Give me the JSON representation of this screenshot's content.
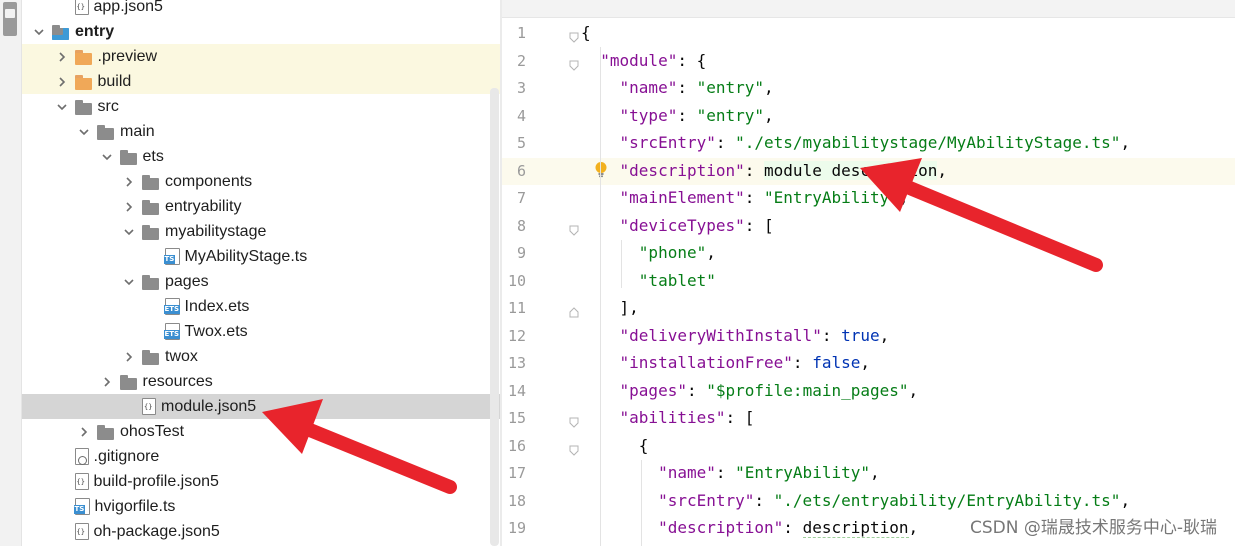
{
  "tree": {
    "items": [
      {
        "label": "app.json5",
        "icon": "json-file-icon",
        "depth": 3,
        "chevron": "none"
      },
      {
        "label": "entry",
        "icon": "module-folder-icon",
        "depth": 2,
        "chevron": "down",
        "bold": true
      },
      {
        "label": ".preview",
        "icon": "excluded-folder-icon",
        "depth": 3,
        "chevron": "right",
        "highlight": true
      },
      {
        "label": "build",
        "icon": "excluded-folder-icon",
        "depth": 3,
        "chevron": "right",
        "highlight": true
      },
      {
        "label": "src",
        "icon": "folder-icon",
        "depth": 3,
        "chevron": "down"
      },
      {
        "label": "main",
        "icon": "folder-icon",
        "depth": 4,
        "chevron": "down"
      },
      {
        "label": "ets",
        "icon": "folder-icon",
        "depth": 5,
        "chevron": "down"
      },
      {
        "label": "components",
        "icon": "folder-icon",
        "depth": 6,
        "chevron": "right"
      },
      {
        "label": "entryability",
        "icon": "folder-icon",
        "depth": 6,
        "chevron": "right"
      },
      {
        "label": "myabilitystage",
        "icon": "folder-icon",
        "depth": 6,
        "chevron": "down"
      },
      {
        "label": "MyAbilityStage.ts",
        "icon": "ts-file-icon",
        "depth": 7,
        "chevron": "none"
      },
      {
        "label": "pages",
        "icon": "folder-icon",
        "depth": 6,
        "chevron": "down"
      },
      {
        "label": "Index.ets",
        "icon": "ets-file-icon",
        "depth": 7,
        "chevron": "none"
      },
      {
        "label": "Twox.ets",
        "icon": "ets-file-icon",
        "depth": 7,
        "chevron": "none"
      },
      {
        "label": "twox",
        "icon": "folder-icon",
        "depth": 6,
        "chevron": "right"
      },
      {
        "label": "resources",
        "icon": "folder-icon",
        "depth": 5,
        "chevron": "right"
      },
      {
        "label": "module.json5",
        "icon": "json-file-icon",
        "depth": 6,
        "chevron": "none",
        "selected": true
      },
      {
        "label": "ohosTest",
        "icon": "folder-icon",
        "depth": 4,
        "chevron": "right"
      },
      {
        "label": ".gitignore",
        "icon": "gitignore-file-icon",
        "depth": 3,
        "chevron": "none"
      },
      {
        "label": "build-profile.json5",
        "icon": "json-file-icon",
        "depth": 3,
        "chevron": "none"
      },
      {
        "label": "hvigorfile.ts",
        "icon": "ts-file-icon",
        "depth": 3,
        "chevron": "none"
      },
      {
        "label": "oh-package.json5",
        "icon": "json-file-icon",
        "depth": 3,
        "chevron": "none"
      }
    ]
  },
  "editor": {
    "current_line": 6,
    "lines": [
      {
        "n": "1",
        "fold": "open",
        "tokens": [
          [
            "p",
            "{"
          ]
        ]
      },
      {
        "n": "2",
        "fold": "open",
        "tokens": [
          [
            "p",
            "  "
          ],
          [
            "key",
            "\"module\""
          ],
          [
            "p",
            ": {"
          ]
        ]
      },
      {
        "n": "3",
        "tokens": [
          [
            "p",
            "    "
          ],
          [
            "key",
            "\"name\""
          ],
          [
            "p",
            ": "
          ],
          [
            "str",
            "\"entry\""
          ],
          [
            "p",
            ","
          ]
        ]
      },
      {
        "n": "4",
        "tokens": [
          [
            "p",
            "    "
          ],
          [
            "key",
            "\"type\""
          ],
          [
            "p",
            ": "
          ],
          [
            "str",
            "\"entry\""
          ],
          [
            "p",
            ","
          ]
        ]
      },
      {
        "n": "5",
        "tokens": [
          [
            "p",
            "    "
          ],
          [
            "key",
            "\"srcEntry\""
          ],
          [
            "p",
            ": "
          ],
          [
            "str",
            "\"./ets/myabilitystage/MyAbilityStage.ts\""
          ],
          [
            "p",
            ","
          ]
        ]
      },
      {
        "n": "6",
        "bulb": true,
        "tokens": [
          [
            "p",
            "    "
          ],
          [
            "key",
            "\"description\""
          ],
          [
            "p",
            ": "
          ],
          [
            "plain",
            "module description"
          ],
          [
            "p",
            ","
          ]
        ]
      },
      {
        "n": "7",
        "tokens": [
          [
            "p",
            "    "
          ],
          [
            "key",
            "\"mainElement\""
          ],
          [
            "p",
            ": "
          ],
          [
            "str",
            "\"EntryAbility\""
          ],
          [
            "p",
            ","
          ]
        ]
      },
      {
        "n": "8",
        "fold": "open",
        "tokens": [
          [
            "p",
            "    "
          ],
          [
            "key",
            "\"deviceTypes\""
          ],
          [
            "p",
            ": ["
          ]
        ]
      },
      {
        "n": "9",
        "tokens": [
          [
            "p",
            "      "
          ],
          [
            "str",
            "\"phone\""
          ],
          [
            "p",
            ","
          ]
        ]
      },
      {
        "n": "10",
        "tokens": [
          [
            "p",
            "      "
          ],
          [
            "str",
            "\"tablet\""
          ]
        ]
      },
      {
        "n": "11",
        "fold": "close",
        "tokens": [
          [
            "p",
            "    ],"
          ]
        ]
      },
      {
        "n": "12",
        "tokens": [
          [
            "p",
            "    "
          ],
          [
            "key",
            "\"deliveryWithInstall\""
          ],
          [
            "p",
            ": "
          ],
          [
            "kw",
            "true"
          ],
          [
            "p",
            ","
          ]
        ]
      },
      {
        "n": "13",
        "tokens": [
          [
            "p",
            "    "
          ],
          [
            "key",
            "\"installationFree\""
          ],
          [
            "p",
            ": "
          ],
          [
            "kw",
            "false"
          ],
          [
            "p",
            ","
          ]
        ]
      },
      {
        "n": "14",
        "tokens": [
          [
            "p",
            "    "
          ],
          [
            "key",
            "\"pages\""
          ],
          [
            "p",
            ": "
          ],
          [
            "str",
            "\"$profile:main_pages\""
          ],
          [
            "p",
            ","
          ]
        ]
      },
      {
        "n": "15",
        "fold": "open",
        "tokens": [
          [
            "p",
            "    "
          ],
          [
            "key",
            "\"abilities\""
          ],
          [
            "p",
            ": ["
          ]
        ]
      },
      {
        "n": "16",
        "fold": "open",
        "tokens": [
          [
            "p",
            "      {"
          ]
        ]
      },
      {
        "n": "17",
        "tokens": [
          [
            "p",
            "        "
          ],
          [
            "key",
            "\"name\""
          ],
          [
            "p",
            ": "
          ],
          [
            "str",
            "\"EntryAbility\""
          ],
          [
            "p",
            ","
          ]
        ]
      },
      {
        "n": "18",
        "tokens": [
          [
            "p",
            "        "
          ],
          [
            "key",
            "\"srcEntry\""
          ],
          [
            "p",
            ": "
          ],
          [
            "str",
            "\"./ets/entryability/EntryAbility.ts\""
          ],
          [
            "p",
            ","
          ]
        ]
      },
      {
        "n": "19",
        "tokens": [
          [
            "p",
            "        "
          ],
          [
            "key",
            "\"description\""
          ],
          [
            "p",
            ": "
          ],
          [
            "plainu",
            "description"
          ],
          [
            "p",
            ","
          ]
        ]
      }
    ]
  },
  "watermark": "CSDN @瑞晟技术服务中心-耿瑞",
  "colors": {
    "arrow": "#e8242c",
    "key": "#871094",
    "string": "#067d17",
    "keyword": "#0033b3",
    "selection": "#d5d5d5",
    "excluded_highlight": "#fbf8e0",
    "excluded_folder": "#f0a858"
  }
}
